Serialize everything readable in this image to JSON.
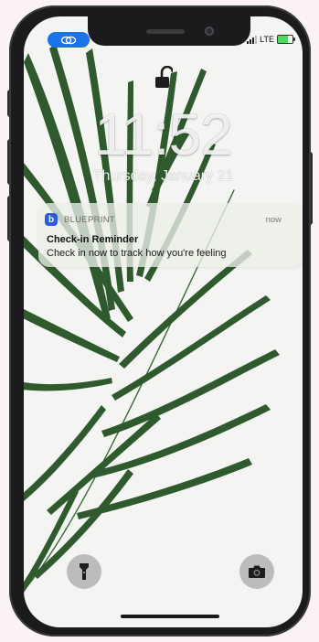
{
  "status_bar": {
    "network": "LTE"
  },
  "lock_screen": {
    "time": "11:52",
    "date": "Thursday, January 21"
  },
  "notification": {
    "app_name": "BLUEPRINT",
    "app_icon_letter": "b",
    "time": "now",
    "title": "Check-in Reminder",
    "body": "Check in now to track how you're feeling"
  },
  "quick_actions": {
    "left_icon": "flashlight-icon",
    "right_icon": "camera-icon"
  },
  "colors": {
    "accent_blue": "#1a73e8",
    "app_icon": "#2d5be3",
    "leaf_green": "#2f5a2e",
    "battery_green": "#4cd964"
  }
}
